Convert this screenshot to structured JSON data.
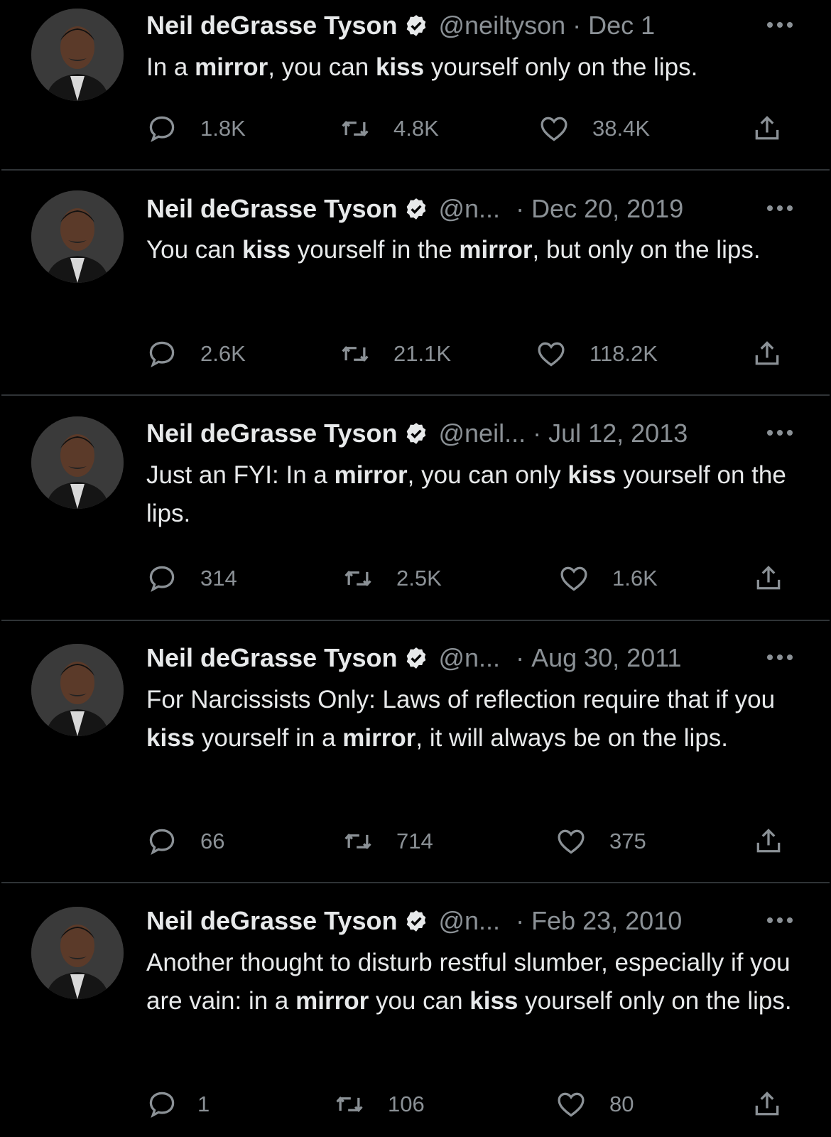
{
  "tweets": [
    {
      "name": "Neil deGrasse Tyson",
      "handle": "@neiltyson",
      "separator": "·",
      "date": "Dec 1",
      "text_parts": [
        "In a ",
        "mirror",
        ", you can ",
        "kiss",
        " yourself only on the lips."
      ],
      "replies": "1.8K",
      "retweets": "4.8K",
      "likes": "38.4K"
    },
    {
      "name": "Neil deGrasse Tyson",
      "handle": "@n...",
      "separator": "·",
      "date": "Dec 20, 2019",
      "text_parts": [
        "You can ",
        "kiss",
        " yourself in the ",
        "mirror",
        ", but only on the lips."
      ],
      "replies": "2.6K",
      "retweets": "21.1K",
      "likes": "118.2K"
    },
    {
      "name": "Neil deGrasse Tyson",
      "handle": "@neil...",
      "separator": "·",
      "date": "Jul 12, 2013",
      "text_parts": [
        "Just an FYI:  In a ",
        "mirror",
        ", you can only ",
        "kiss",
        " yourself on the lips."
      ],
      "replies": "314",
      "retweets": "2.5K",
      "likes": "1.6K"
    },
    {
      "name": "Neil deGrasse Tyson",
      "handle": "@n...",
      "separator": "·",
      "date": "Aug 30, 2011",
      "text_parts": [
        "For Narcissists Only: Laws of reflection require that if you ",
        "kiss",
        " yourself in a ",
        "mirror",
        ", it will always be on the lips."
      ],
      "replies": "66",
      "retweets": "714",
      "likes": "375"
    },
    {
      "name": "Neil deGrasse Tyson",
      "handle": "@n...",
      "separator": "·",
      "date": "Feb 23, 2010",
      "text_parts": [
        "Another thought to disturb restful slumber, especially if you are vain: in a ",
        "mirror",
        " you can ",
        "kiss",
        " yourself only on the lips."
      ],
      "replies": "1",
      "retweets": "106",
      "likes": "80"
    }
  ],
  "icons": {
    "reply": "reply-icon",
    "retweet": "retweet-icon",
    "like": "heart-icon",
    "share": "share-icon",
    "more": "more-icon",
    "verified": "verified-badge-icon"
  },
  "colors": {
    "background": "#000000",
    "text": "#e7e9ea",
    "muted": "#8b9196",
    "divider": "#2f3336"
  }
}
